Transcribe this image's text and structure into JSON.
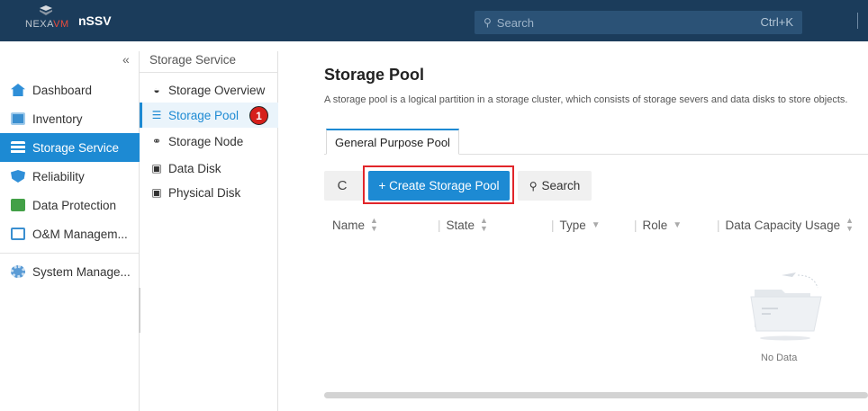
{
  "header": {
    "logo_text_a": "NEXA",
    "logo_text_b": "VM",
    "app_name": "nSSV",
    "search_placeholder": "Search",
    "search_shortcut": "Ctrl+K"
  },
  "leftnav": {
    "collapse_glyph": "«",
    "items": [
      {
        "label": "Dashboard",
        "icon": "home-icon",
        "color": "#2f8fd8"
      },
      {
        "label": "Inventory",
        "icon": "inventory-icon",
        "color": "#3a8fd0"
      },
      {
        "label": "Storage Service",
        "icon": "storage-service-icon",
        "color": "#ffffff"
      },
      {
        "label": "Reliability",
        "icon": "shield-icon",
        "color": "#2f8fd8"
      },
      {
        "label": "Data Protection",
        "icon": "data-protection-icon",
        "color": "#43a047"
      },
      {
        "label": "O&M Managem...",
        "icon": "monitor-icon",
        "color": "#3a8fd0"
      },
      {
        "label": "System Manage...",
        "icon": "gear-icon",
        "color": "#5a9bd5"
      }
    ]
  },
  "subnav": {
    "title": "Storage Service",
    "items": [
      {
        "label": "Storage Overview",
        "icon": "overview-icon",
        "glyph": "◒"
      },
      {
        "label": "Storage Pool",
        "icon": "database-icon",
        "glyph": "☰"
      },
      {
        "label": "Storage Node",
        "icon": "node-icon",
        "glyph": "⚭"
      },
      {
        "label": "Data Disk",
        "icon": "disk-icon",
        "glyph": "▣"
      },
      {
        "label": "Physical Disk",
        "icon": "physical-disk-icon",
        "glyph": "▣"
      }
    ],
    "badge": "1"
  },
  "main": {
    "title": "Storage Pool",
    "description": "A storage pool is a logical partition in a storage cluster, which consists of storage severs and data disks to store objects.",
    "tab": "General Purpose Pool",
    "toolbar": {
      "refresh_glyph": "C",
      "create_label": "+ Create Storage Pool",
      "search_label": "Search"
    },
    "columns": [
      {
        "label": "Name",
        "marker": "sort"
      },
      {
        "label": "State",
        "marker": "sort"
      },
      {
        "label": "Type",
        "marker": "filter"
      },
      {
        "label": "Role",
        "marker": "filter"
      },
      {
        "label": "Data Capacity Usage",
        "marker": "sort"
      }
    ],
    "empty_text": "No Data"
  },
  "colors": {
    "topbar": "#1b3c5b",
    "accent": "#1d8ad3",
    "highlight": "#e1252a"
  }
}
